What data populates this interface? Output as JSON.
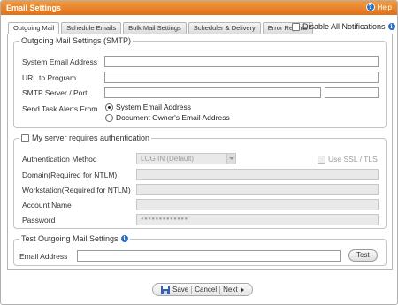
{
  "window": {
    "title": "Email Settings",
    "help_label": "Help"
  },
  "tabs": [
    {
      "label": "Outgoing Mail",
      "active": true
    },
    {
      "label": "Schedule Emails"
    },
    {
      "label": "Bulk Mail Settings"
    },
    {
      "label": "Scheduler & Delivery"
    },
    {
      "label": "Error Reports"
    }
  ],
  "disable_all": {
    "label": "Disable All Notifications",
    "checked": false
  },
  "smtp": {
    "legend": "Outgoing Mail Settings (SMTP)",
    "system_email_label": "System Email Address",
    "system_email_value": "",
    "url_label": "URL to Program",
    "url_value": "",
    "server_port_label": "SMTP Server / Port",
    "server_value": "",
    "port_value": "",
    "alerts_label": "Send Task Alerts From",
    "alert_options": [
      "System Email Address",
      "Document Owner's Email Address"
    ],
    "alert_selected": "System Email Address"
  },
  "auth": {
    "legend": "My server requires authentication",
    "checked": false,
    "method_label": "Authentication Method",
    "method_value": "LOG IN (Default)",
    "ssl_label": "Use SSL / TLS",
    "domain_label": "Domain(Required for NTLM)",
    "workstation_label": "Workstation(Required for NTLM)",
    "account_label": "Account Name",
    "password_label": "Password",
    "password_value": "●●●●●●●●●●●●●"
  },
  "test": {
    "legend": "Test Outgoing Mail Settings",
    "email_label": "Email Address",
    "email_value": "",
    "button_label": "Test"
  },
  "footer": {
    "save_label": "Save",
    "cancel_label": "Cancel",
    "next_label": "Next"
  }
}
